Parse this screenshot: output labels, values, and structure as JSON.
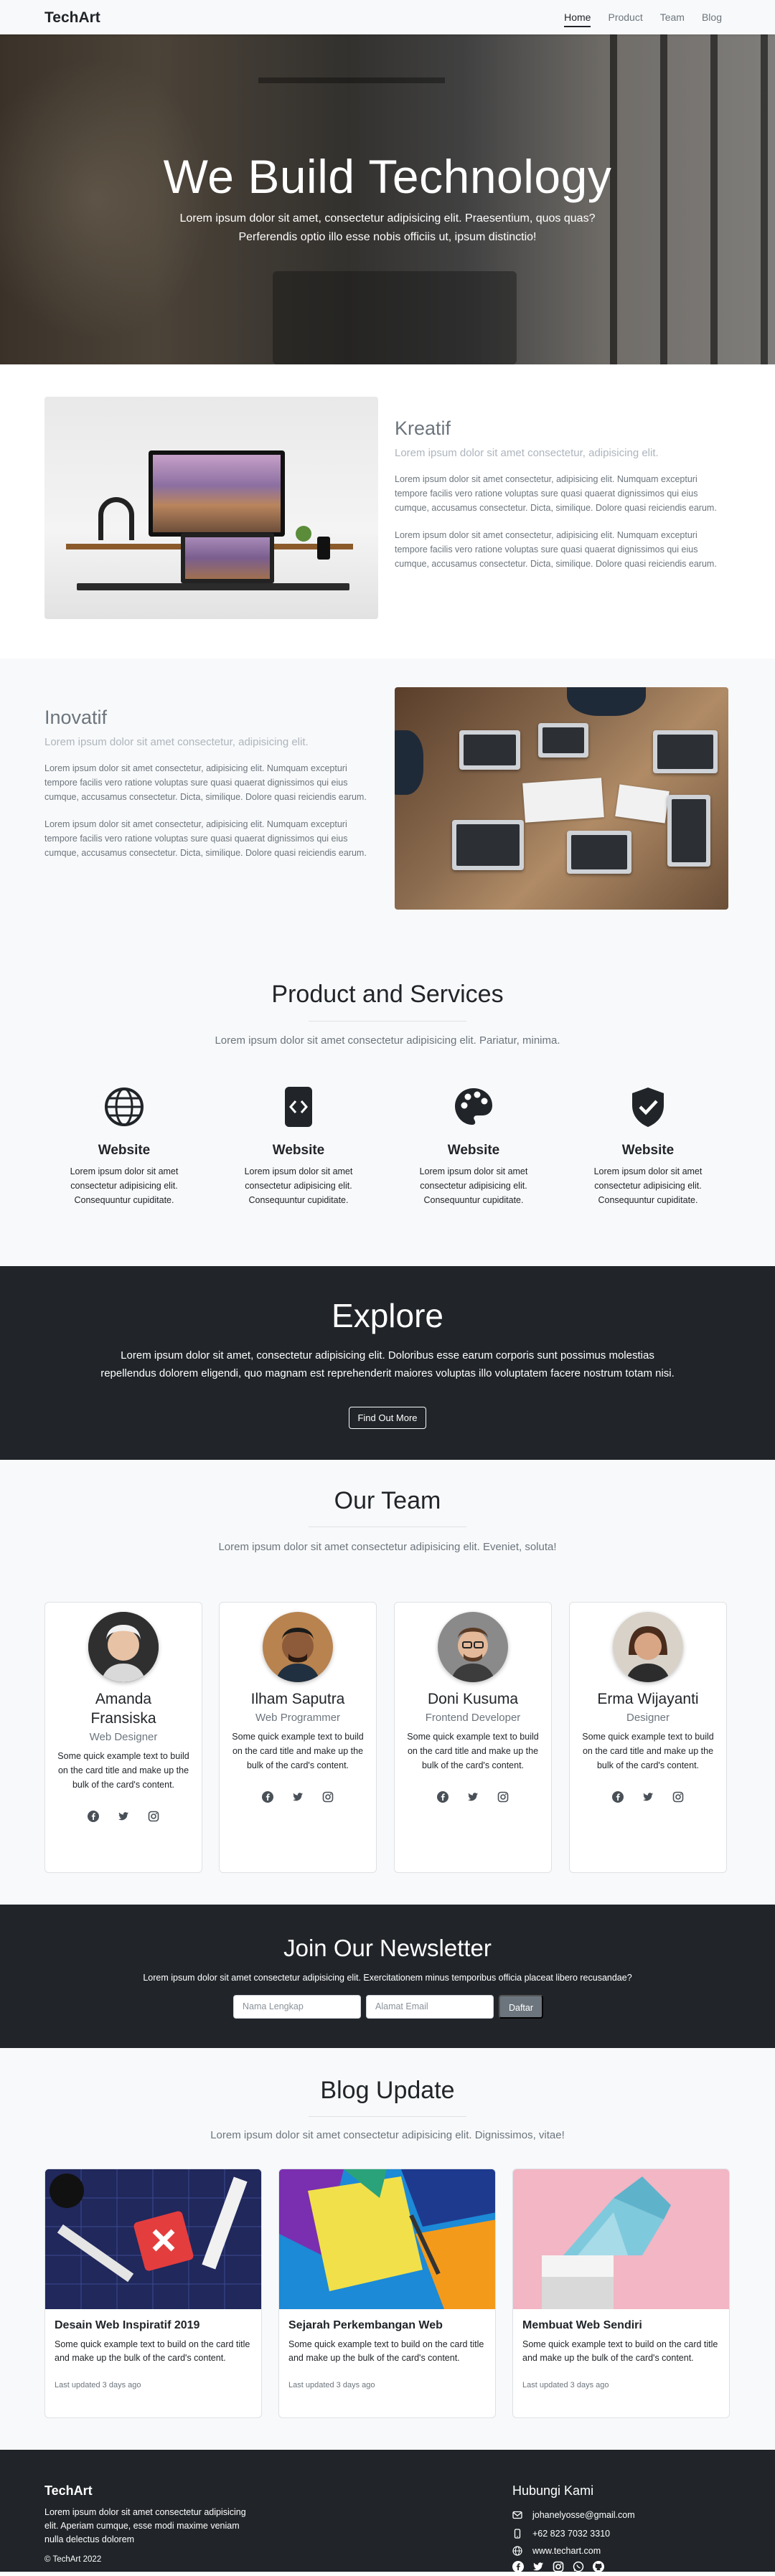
{
  "navbar": {
    "brand": "TechArt",
    "links": [
      "Home",
      "Product",
      "Team",
      "Blog"
    ]
  },
  "hero": {
    "title_part1": "We Build ",
    "title_part2": "Technology",
    "subtitle_line1": "Lorem ipsum dolor sit amet, consectetur adipisicing elit. Praesentium, quos quas?",
    "subtitle_line2": "Perferendis optio illo esse nobis officiis ut, ipsum distinctio!"
  },
  "features": [
    {
      "title": "Kreatif",
      "lead": "Lorem ipsum dolor sit amet consectetur, adipisicing elit.",
      "p1": "Lorem ipsum dolor sit amet consectetur, adipisicing elit. Numquam excepturi tempore facilis vero ratione voluptas sure quasi quaerat dignissimos qui eius cumque, accusamus consectetur. Dicta, similique. Dolore quasi reiciendis earum.",
      "p2": "Lorem ipsum dolor sit amet consectetur, adipisicing elit. Numquam excepturi tempore facilis vero ratione voluptas sure quasi quaerat dignissimos qui eius cumque, accusamus consectetur. Dicta, similique. Dolore quasi reiciendis earum."
    },
    {
      "title": "Inovatif",
      "lead": "Lorem ipsum dolor sit amet consectetur, adipisicing elit.",
      "p1": "Lorem ipsum dolor sit amet consectetur, adipisicing elit. Numquam excepturi tempore facilis vero ratione voluptas sure quasi quaerat dignissimos qui eius cumque, accusamus consectetur. Dicta, similique. Dolore quasi reiciendis earum.",
      "p2": "Lorem ipsum dolor sit amet consectetur, adipisicing elit. Numquam excepturi tempore facilis vero ratione voluptas sure quasi quaerat dignissimos qui eius cumque, accusamus consectetur. Dicta, similique. Dolore quasi reiciendis earum."
    }
  ],
  "services": {
    "title": "Product and Services",
    "lead": "Lorem ipsum dolor sit amet consectetur adipisicing elit. Pariatur, minima.",
    "items": [
      {
        "icon": "globe-icon",
        "title": "Website",
        "text": "Lorem ipsum dolor sit amet consectetur adipisicing elit. Consequuntur cupiditate."
      },
      {
        "icon": "code-file-icon",
        "title": "Website",
        "text": "Lorem ipsum dolor sit amet consectetur adipisicing elit. Consequuntur cupiditate."
      },
      {
        "icon": "palette-icon",
        "title": "Website",
        "text": "Lorem ipsum dolor sit amet consectetur adipisicing elit. Consequuntur cupiditate."
      },
      {
        "icon": "shield-check-icon",
        "title": "Website",
        "text": "Lorem ipsum dolor sit amet consectetur adipisicing elit. Consequuntur cupiditate."
      }
    ]
  },
  "explore": {
    "title": "Explore",
    "text": "Lorem ipsum dolor sit amet, consectetur adipisicing elit. Doloribus esse earum corporis sunt possimus molestias repellendus dolorem eligendi, quo magnam est reprehenderit maiores voluptas illo voluptatem facere nostrum totam nisi.",
    "button": "Find Out More"
  },
  "team": {
    "title": "Our Team",
    "lead": "Lorem ipsum dolor sit amet consectetur adipisicing elit. Eveniet, soluta!",
    "members": [
      {
        "name_line1": "Amanda",
        "name_line2": "Fransiska",
        "role": "Web Designer",
        "text": "Some quick example text to build on the card title and make up the bulk of the card's content."
      },
      {
        "name_line1": "Ilham Saputra",
        "name_line2": "",
        "role": "Web Programmer",
        "text": "Some quick example text to build on the card title and make up the bulk of the card's content."
      },
      {
        "name_line1": "Doni Kusuma",
        "name_line2": "",
        "role": "Frontend Developer",
        "text": "Some quick example text to build on the card title and make up the bulk of the card's content."
      },
      {
        "name_line1": "Erma Wijayanti",
        "name_line2": "",
        "role": "Designer",
        "text": "Some quick example text to build on the card title and make up the bulk of the card's content."
      }
    ]
  },
  "newsletter": {
    "title": "Join Our Newsletter",
    "text": "Lorem ipsum dolor sit amet consectetur adipisicing elit. Exercitationem minus temporibus officia placeat libero recusandae?",
    "name_placeholder": "Nama Lengkap",
    "email_placeholder": "Alamat Email",
    "button": "Daftar"
  },
  "blog": {
    "title": "Blog Update",
    "lead": "Lorem ipsum dolor sit amet consectetur adipisicing elit. Dignissimos, vitae!",
    "posts": [
      {
        "title": "Desain Web Inspiratif 2019",
        "text": "Some quick example text to build on the card title and make up the bulk of the card's content.",
        "meta": "Last updated 3 days ago"
      },
      {
        "title": "Sejarah Perkembangan Web",
        "text": "Some quick example text to build on the card title and make up the bulk of the card's content.",
        "meta": "Last updated 3 days ago"
      },
      {
        "title": "Membuat Web Sendiri",
        "text": "Some quick example text to build on the card title and make up the bulk of the card's content.",
        "meta": "Last updated 3 days ago"
      }
    ]
  },
  "footer": {
    "brand": "TechArt",
    "text": "Lorem ipsum dolor sit amet consectetur adipisicing elit. Aperiam cumque, esse modi maxime veniam nulla delectus dolorem",
    "copyright": "© TechArt 2022",
    "contact_title": "Hubungi Kami",
    "email": "johanelyosse@gmail.com",
    "phone": "+62 823 7032 3310",
    "website": "www.techart.com"
  },
  "colors": {
    "dark": "#212529",
    "muted": "#6c757d",
    "light": "#f8f9fa"
  }
}
